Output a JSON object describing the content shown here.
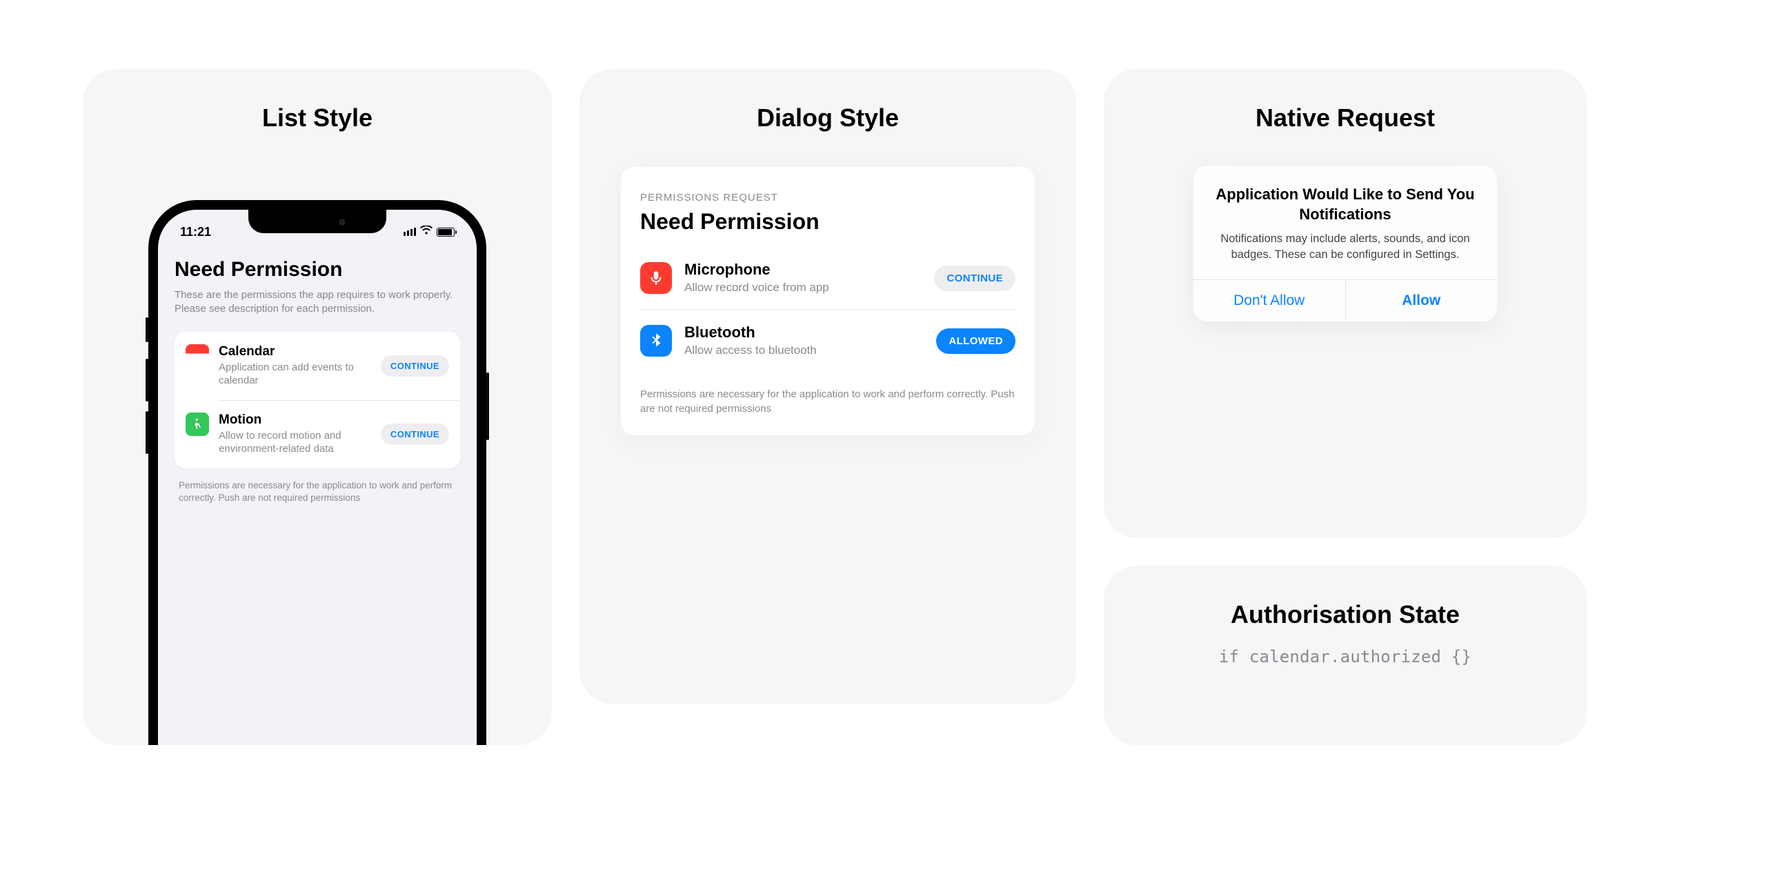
{
  "panel1": {
    "title": "List Style",
    "status_time": "11:21",
    "heading": "Need Permission",
    "subheading": "These are the permissions the app requires to work properly. Please see description for each permission.",
    "rows": [
      {
        "title": "Calendar",
        "desc": "Application can add events to calendar",
        "btn": "CONTINUE"
      },
      {
        "title": "Motion",
        "desc": "Allow to record motion and environment-related data",
        "btn": "CONTINUE"
      }
    ],
    "footer": "Permissions are necessary for the application to work and perform correctly. Push are not required permissions"
  },
  "panel2": {
    "title": "Dialog Style",
    "eyebrow": "PERMISSIONS REQUEST",
    "heading": "Need Permission",
    "rows": [
      {
        "title": "Microphone",
        "desc": "Allow record voice from app",
        "btn": "CONTINUE",
        "state": "gray"
      },
      {
        "title": "Bluetooth",
        "desc": "Allow access to bluetooth",
        "btn": "ALLOWED",
        "state": "blue"
      }
    ],
    "footer": "Permissions are necessary for the application to work and perform correctly. Push are not required permissions"
  },
  "panel3a": {
    "title": "Native Request",
    "alert_title": "Application Would Like to Send You Notifications",
    "alert_msg": "Notifications may include alerts, sounds, and icon badges. These can be configured in Settings.",
    "deny": "Don't Allow",
    "allow": "Allow"
  },
  "panel3b": {
    "title": "Authorisation State",
    "code": "if calendar.authorized {}"
  }
}
